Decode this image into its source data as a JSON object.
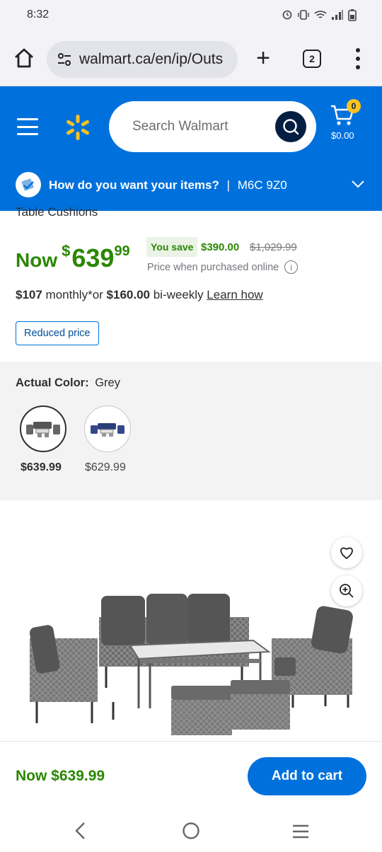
{
  "status_bar": {
    "time": "8:32"
  },
  "browser": {
    "url": "walmart.ca/en/ip/Outs",
    "tab_count": "2"
  },
  "header": {
    "search_placeholder": "Search Walmart",
    "cart_count": "0",
    "cart_total": "$0.00"
  },
  "delivery": {
    "question": "How do you want your items?",
    "separator": "|",
    "postal_code": "M6C 9Z0"
  },
  "product": {
    "title_tail": "Table Cushions",
    "now_label": "Now",
    "price_dollar_sign": "$",
    "price_whole": "639",
    "price_cents": "99",
    "save_label": "You save",
    "save_amount": "$390.00",
    "was_price": "$1,029.99",
    "online_note": "Price when purchased online",
    "financing_monthly": "$107",
    "financing_monthly_suffix": " monthly*or ",
    "financing_biweekly": "$160.00",
    "financing_biweekly_suffix": " bi-weekly ",
    "learn_how": "Learn how",
    "reduced_tag": "Reduced price"
  },
  "variants": {
    "label": "Actual Color:",
    "selected_value": "Grey",
    "options": [
      {
        "price": "$639.99",
        "selected": true
      },
      {
        "price": "$629.99",
        "selected": false
      }
    ]
  },
  "sticky": {
    "price": "Now $639.99",
    "add_to_cart": "Add to cart"
  },
  "colors": {
    "brand_blue": "#0071dc",
    "spark_yellow": "#ffc220",
    "price_green": "#2a8703",
    "navy": "#041e42"
  }
}
